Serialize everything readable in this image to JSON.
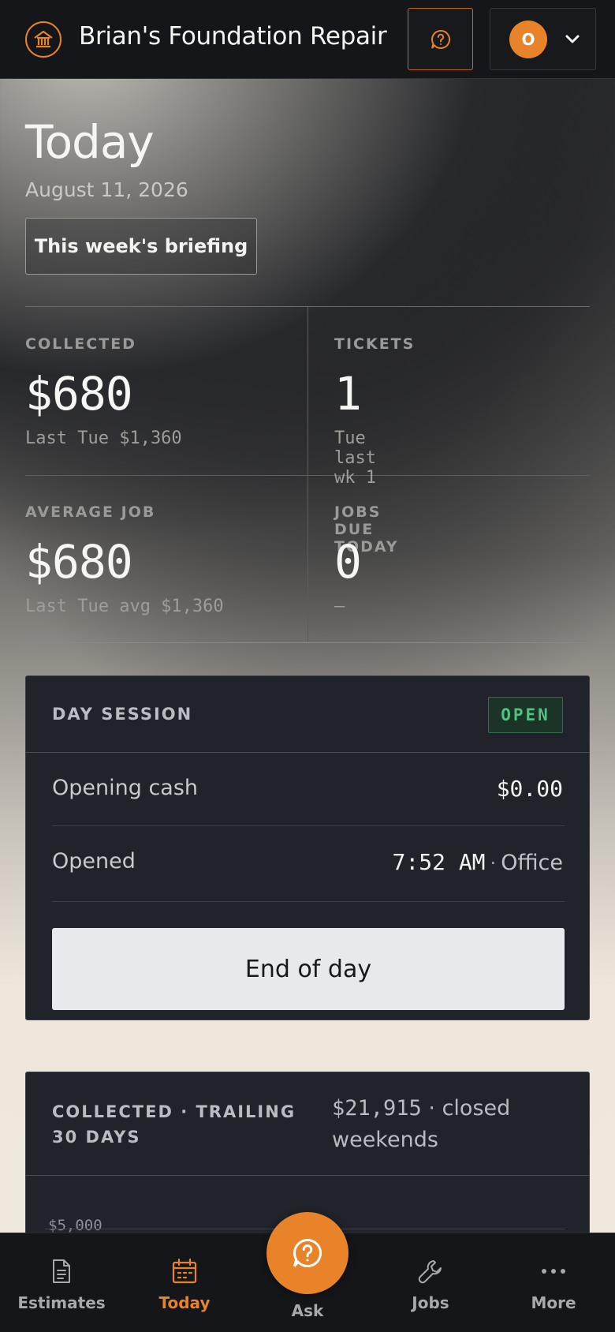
{
  "header": {
    "brand_icon": "house-icon",
    "business_name": "Brian's Foundation Repair",
    "help_icon": "help-chat-icon",
    "avatar_initial": "O",
    "account_chevron": "chevron-down-icon",
    "accent_color": "#e8832a"
  },
  "today": {
    "title": "Today",
    "date": "August 11, 2026",
    "briefing_label": "This week's briefing"
  },
  "stats": [
    {
      "label": "COLLECTED",
      "value": "$680",
      "sub": "Last Tue $1,360"
    },
    {
      "label": "TICKETS",
      "value": "1",
      "sub": "Tue last wk 1"
    },
    {
      "label": "AVERAGE JOB",
      "value": "$680",
      "sub": "Last Tue avg $1,360"
    },
    {
      "label": "JOBS DUE TODAY",
      "value": "0",
      "sub": "—"
    }
  ],
  "day_session": {
    "title": "DAY SESSION",
    "status": "OPEN",
    "status_color": "#4fc27f",
    "opening_cash_label": "Opening cash",
    "opening_cash_value": "$0.00",
    "opened_label": "Opened",
    "opened_time": "7:52 AM",
    "opened_separator": "·",
    "opened_location": "Office",
    "end_of_day_label": "End of day"
  },
  "trailing": {
    "title": "COLLECTED · TRAILING 30 DAYS",
    "total": "$21,915",
    "separator": "·",
    "note": "closed weekends",
    "y_tick_top": "$5,000"
  },
  "nav": {
    "items": [
      {
        "label": "Estimates",
        "icon": "document-icon"
      },
      {
        "label": "Today",
        "icon": "calendar-icon",
        "active": true
      },
      {
        "label": "Jobs",
        "icon": "wrench-icon"
      },
      {
        "label": "More",
        "icon": "more-dots-icon"
      }
    ],
    "ask_label": "Ask",
    "ask_icon": "help-chat-icon"
  }
}
